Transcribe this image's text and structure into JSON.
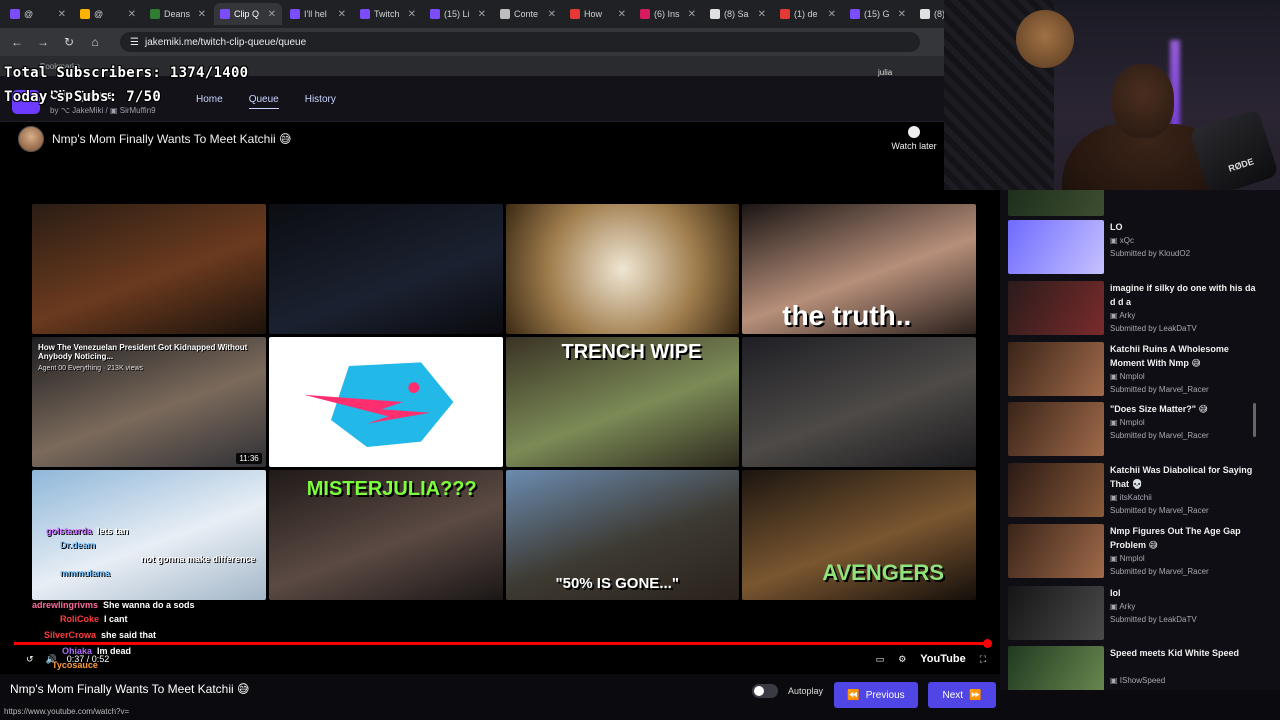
{
  "browser": {
    "tabs": [
      {
        "label": "@",
        "color": "#7c4dff"
      },
      {
        "label": "@",
        "color": "#ffb300"
      },
      {
        "label": "Deans",
        "color": "#2e7d32"
      },
      {
        "label": "Clip Q",
        "color": "#7c4dff",
        "active": true
      },
      {
        "label": "I'll hel",
        "color": "#7c4dff"
      },
      {
        "label": "Twitch",
        "color": "#7c4dff"
      },
      {
        "label": "(15) Li",
        "color": "#7c4dff"
      },
      {
        "label": "Conte",
        "color": "#bdbdbd"
      },
      {
        "label": "How",
        "color": "#e53935"
      },
      {
        "label": "(6) Ins",
        "color": "#d81b60"
      },
      {
        "label": "(8) Sa",
        "color": "#e0e0e0"
      },
      {
        "label": "(1) de",
        "color": "#e53935"
      },
      {
        "label": "(15) G",
        "color": "#7c4dff"
      },
      {
        "label": "(8) Da",
        "color": "#e0e0e0"
      }
    ],
    "url": "jakemiki.me/twitch-clip-queue/queue",
    "bookmarks": [
      "Bookmarks"
    ]
  },
  "overlay": {
    "total_subs": "Total Subscribers: 1374/1400",
    "today_subs": "Today's Subs: 7/50"
  },
  "app": {
    "brand": "Clip Queue",
    "by": "by",
    "author1": "JakeMiki",
    "author2": "SirMuffin9",
    "nav": [
      "Home",
      "Queue",
      "History"
    ],
    "user": "julia"
  },
  "video": {
    "title": "Nmp's Mom Finally Wants To Meet Katchii 😅",
    "watch_later": "Watch later",
    "thumbs": [
      {
        "caption": "",
        "bg": "linear-gradient(160deg,#2a1d14,#6b3a1e 55%,#1b120c)"
      },
      {
        "caption": "",
        "bg": "linear-gradient(160deg,#0b0d12,#1b2130 60%,#0a0a0e)"
      },
      {
        "caption": "",
        "bg": "radial-gradient(circle,#efe6d3 0%,#a07d4d 55%,#3b2a14 100%)"
      },
      {
        "caption": "the truth..",
        "bg": "linear-gradient(160deg,#1a1514,#b78f7a 55%,#2a201c)"
      },
      {
        "caption": "",
        "bg": "linear-gradient(160deg,#1e1e22,#7b6a5b 55%,#303036)",
        "note": "How The Venezuelan President Got Kidnapped Without Anybody Noticing...",
        "meta": "Agent 00 Everything · 213K views",
        "dur": "11:36"
      },
      {
        "caption": "",
        "bg": "#ffffff"
      },
      {
        "caption": "TRENCH WIPE",
        "bg": "linear-gradient(160deg,#3a3225,#7b8b56 55%,#2e2a1e)"
      },
      {
        "caption": "",
        "bg": "linear-gradient(160deg,#1e1e24,#4d4a47 55%,#1b1a1d)"
      },
      {
        "caption": "",
        "bg": "linear-gradient(160deg,#8fb7d9,#e8eef5 55%,#a4b7c8)"
      },
      {
        "caption": "MISTERJULIA???",
        "bg": "linear-gradient(160deg,#201a18,#5b4a43 55%,#1a1616)"
      },
      {
        "caption": "\"50% IS GONE...\"",
        "bg": "linear-gradient(160deg,#6b8bb0,#3d3a32 55%,#2a221c)"
      },
      {
        "caption": "AVENGERS",
        "bg": "linear-gradient(160deg,#1b1510,#7a5630 55%,#140e0a)"
      }
    ],
    "time": "0:37 / 0:52",
    "youtube": "YouTube",
    "progress": 0.998
  },
  "chat": [
    {
      "user": "golstaurda",
      "text": "lets tan",
      "color": "#c36bff"
    },
    {
      "user": "Dr.deam",
      "text": "",
      "color": "#7cc3ff"
    },
    {
      "user": "",
      "text": "not gonna make difference",
      "color": "#7cc3ff"
    },
    {
      "user": "mmmulama",
      "text": "",
      "color": "#7cc3ff"
    },
    {
      "user": "adrewlingrivms",
      "text": "She wanna do a sods",
      "color": "#ff6b9b"
    },
    {
      "user": "RoliCoke",
      "text": "I cant",
      "color": "#ff3b3b"
    },
    {
      "user": "SilverCrowa",
      "text": "she said that",
      "color": "#ff3b3b"
    },
    {
      "user": "Ohiaka",
      "text": "Im dead",
      "color": "#b06bff"
    },
    {
      "user": "Tycosauce",
      "text": "",
      "color": "#ff9b3b"
    },
    {
      "user": "dyeus79",
      "text": "",
      "color": "#3bd1ff"
    },
    {
      "user": "",
      "text": "she said that",
      "color": "#fff"
    },
    {
      "user": "dredraides",
      "text": "Deansocannotread",
      "color": "#ff6b6b"
    }
  ],
  "bottom": {
    "title": "Nmp's Mom Finally Wants To Meet Katchii 😅",
    "status_url": "https://www.youtube.com/watch?v=",
    "autoplay": "Autoplay",
    "previous": "Previous",
    "next": "Next"
  },
  "queue": [
    {
      "title": "",
      "channel": "",
      "submitted": "Submitted by LeakDaTV",
      "bg": "linear-gradient(120deg,#1a2a1a,#3d4e30)"
    },
    {
      "title": "LO",
      "channel": "xQc",
      "submitted": "Submitted by KloudO2",
      "bg": "linear-gradient(120deg,#6f6bff,#c6c2ff)"
    },
    {
      "title": "imagine if silky do one with his da d d a",
      "channel": "Arky",
      "submitted": "Submitted by LeakDaTV",
      "bg": "linear-gradient(120deg,#2b1b1b,#7a2b2b)"
    },
    {
      "title": "Katchii Ruins A Wholesome Moment With Nmp 😅",
      "channel": "Nmplol",
      "submitted": "Submitted by Marvel_Racer",
      "bg": "linear-gradient(120deg,#3a2418,#a06a4a)"
    },
    {
      "title": "\"Does Size Matter?\" 😅",
      "channel": "Nmplol",
      "submitted": "Submitted by Marvel_Racer",
      "bg": "linear-gradient(120deg,#3a2418,#a06a4a)"
    },
    {
      "title": "Katchii Was Diabolical for Saying That 💀",
      "channel": "itsKatchii",
      "submitted": "Submitted by Marvel_Racer",
      "bg": "linear-gradient(120deg,#2a1a14,#8a5a3a)"
    },
    {
      "title": "Nmp Figures Out The Age Gap Problem 😅",
      "channel": "Nmplol",
      "submitted": "Submitted by Marvel_Racer",
      "bg": "linear-gradient(120deg,#3a2418,#a06a4a)"
    },
    {
      "title": "lol",
      "channel": "Arky",
      "submitted": "Submitted by LeakDaTV",
      "bg": "linear-gradient(120deg,#151515,#4a4a4a)"
    },
    {
      "title": "Speed meets Kid White Speed",
      "channel": "IShowSpeed",
      "submitted": "Submitted by LeakDaTV",
      "bg": "linear-gradient(120deg,#203a20,#6a8a50)"
    }
  ],
  "webcam": {
    "mic_text": "RØDE"
  }
}
